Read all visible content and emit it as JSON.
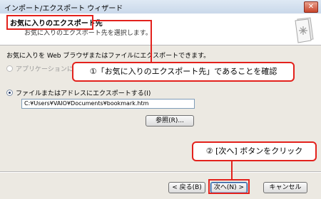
{
  "window": {
    "title": "インポート/エクスポート ウィザード",
    "close_glyph": "✕"
  },
  "header": {
    "title": "お気に入りのエクスポート先",
    "subtitle": "お気に入りのエクスポート先を選択します。",
    "icon": "document-star-icon"
  },
  "body": {
    "intro": "お気に入りを Web ブラウザまたはファイルにエクスポートできます。",
    "option_app_label": "アプリケーションにエクスポートする",
    "option_app_selected": false,
    "option_app_enabled": false,
    "option_file_label": "ファイルまたはアドレスにエクスポートする(I)",
    "option_file_selected": true,
    "file_path_value": "C:¥Users¥VAIO¥Documents¥bookmark.htm",
    "browse_label": "参照(R)..."
  },
  "footer": {
    "back_label": "< 戻る(B)",
    "next_label": "次へ(N) >",
    "cancel_label": "キャンセル"
  },
  "annotations": {
    "callout1": "①「お気に入りのエクスポート先」であることを確認",
    "callout2": "② [次へ] ボタンをクリック",
    "highlight_color": "#e3211c"
  }
}
